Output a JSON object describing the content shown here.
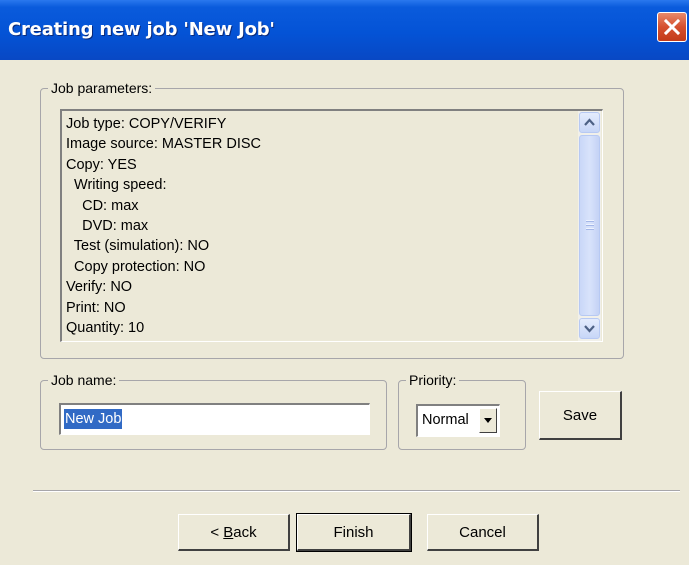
{
  "window": {
    "title": "Creating new job 'New Job'"
  },
  "job_parameters": {
    "legend": "Job parameters:",
    "lines": [
      "Job type: COPY/VERIFY",
      "Image source: MASTER DISC",
      "Copy: YES",
      "  Writing speed:",
      "    CD: max",
      "    DVD: max",
      "  Test (simulation): NO",
      "  Copy protection: NO",
      "Verify: NO",
      "Print: NO",
      "Quantity: 10"
    ]
  },
  "job_name": {
    "legend": "Job name:",
    "value": "New Job"
  },
  "priority": {
    "legend": "Priority:",
    "selected": "Normal"
  },
  "buttons": {
    "save": "Save",
    "back": "< Back",
    "finish": "Finish",
    "cancel": "Cancel"
  },
  "icons": {
    "close": "close-icon",
    "scroll_up": "scroll-up-arrow-icon",
    "scroll_down": "scroll-down-arrow-icon",
    "dropdown": "dropdown-arrow-icon"
  },
  "colors": {
    "titlebar": "#0453d6",
    "close": "#d5502f",
    "dialog_bg": "#ECE9D8",
    "selection": "#316ac5"
  }
}
